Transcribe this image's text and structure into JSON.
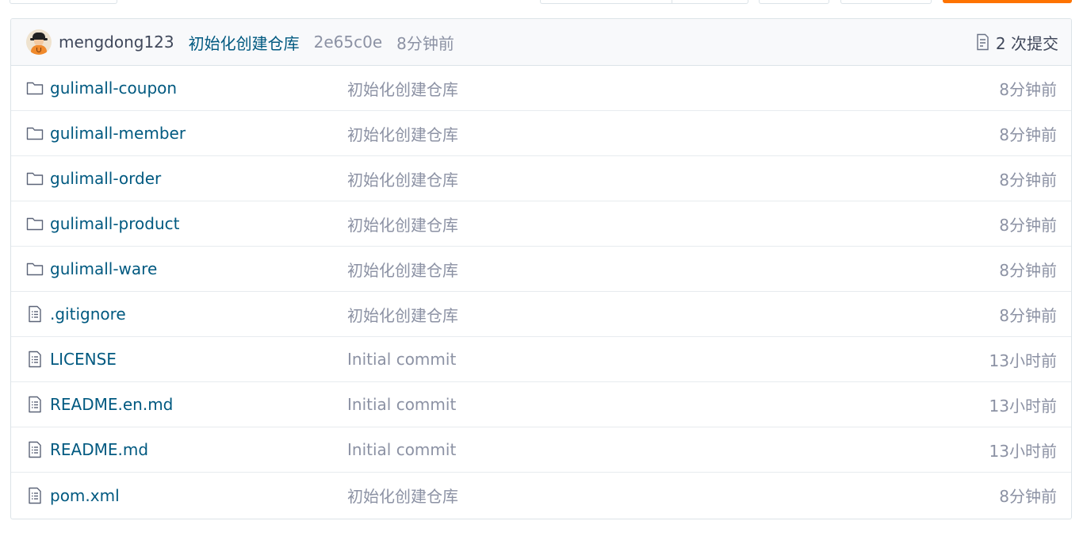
{
  "colors": {
    "link": "#005980",
    "muted": "#8c92a4",
    "text": "#40485b",
    "border": "#dce3e8",
    "accent": "#fe7300"
  },
  "last_commit": {
    "author": "mengdong123",
    "message": "初始化创建仓库",
    "sha": "2e65c0e",
    "time": "8分钟前",
    "commits_count_label": "2 次提交",
    "commits_icon": "commit-list-icon"
  },
  "files": [
    {
      "type": "folder",
      "icon": "folder-icon",
      "name": "gulimall-coupon",
      "commit": "初始化创建仓库",
      "time": "8分钟前"
    },
    {
      "type": "folder",
      "icon": "folder-icon",
      "name": "gulimall-member",
      "commit": "初始化创建仓库",
      "time": "8分钟前"
    },
    {
      "type": "folder",
      "icon": "folder-icon",
      "name": "gulimall-order",
      "commit": "初始化创建仓库",
      "time": "8分钟前"
    },
    {
      "type": "folder",
      "icon": "folder-icon",
      "name": "gulimall-product",
      "commit": "初始化创建仓库",
      "time": "8分钟前"
    },
    {
      "type": "folder",
      "icon": "folder-icon",
      "name": "gulimall-ware",
      "commit": "初始化创建仓库",
      "time": "8分钟前"
    },
    {
      "type": "file",
      "icon": "file-icon",
      "name": ".gitignore",
      "commit": "初始化创建仓库",
      "time": "8分钟前"
    },
    {
      "type": "file",
      "icon": "file-icon",
      "name": "LICENSE",
      "commit": "Initial commit",
      "time": "13小时前"
    },
    {
      "type": "file",
      "icon": "file-icon",
      "name": "README.en.md",
      "commit": "Initial commit",
      "time": "13小时前"
    },
    {
      "type": "file",
      "icon": "file-icon",
      "name": "README.md",
      "commit": "Initial commit",
      "time": "13小时前"
    },
    {
      "type": "file",
      "icon": "file-icon",
      "name": "pom.xml",
      "commit": "初始化创建仓库",
      "time": "8分钟前"
    }
  ]
}
